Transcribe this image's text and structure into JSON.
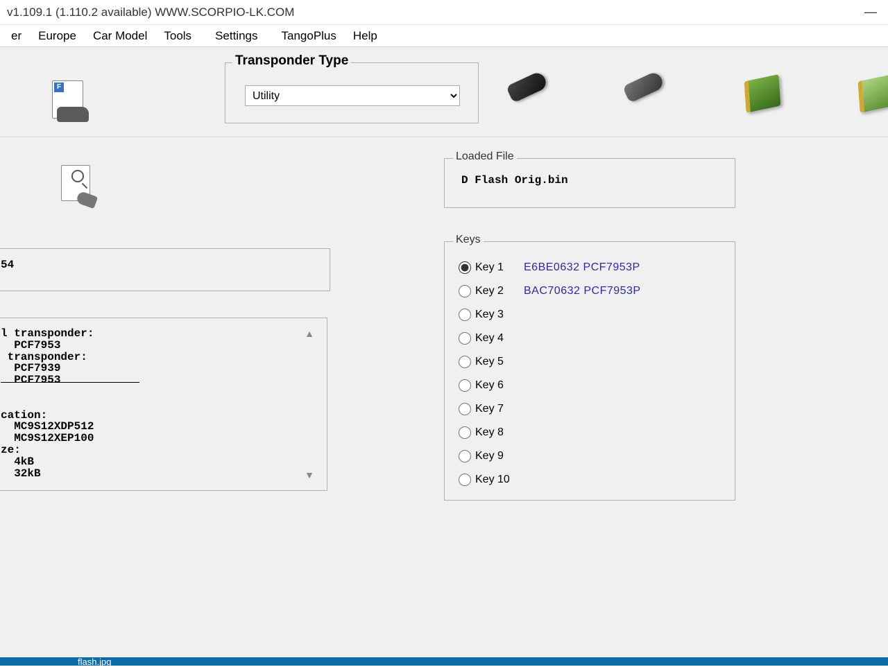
{
  "titlebar": {
    "text": " v1.109.1  (1.110.2 available)   WWW.SCORPIO-LK.COM"
  },
  "menu": {
    "items": [
      "er",
      "Europe",
      "Car Model",
      "Tools",
      "Settings",
      "TangoPlus",
      "Help"
    ]
  },
  "transponder": {
    "legend": "Transponder Type",
    "selected": "Utility"
  },
  "loadedFile": {
    "legend": "Loaded File",
    "name": "D Flash Orig.bin"
  },
  "keysBox": {
    "legend": "Keys",
    "items": [
      {
        "label": "Key 1",
        "data": "E6BE0632   PCF7953P",
        "checked": true
      },
      {
        "label": "Key 2",
        "data": "BAC70632   PCF7953P",
        "checked": false
      },
      {
        "label": "Key 3",
        "data": "",
        "checked": false
      },
      {
        "label": "Key 4",
        "data": "",
        "checked": false
      },
      {
        "label": "Key 5",
        "data": "",
        "checked": false
      },
      {
        "label": "Key 6",
        "data": "",
        "checked": false
      },
      {
        "label": "Key 7",
        "data": "",
        "checked": false
      },
      {
        "label": "Key 8",
        "data": "",
        "checked": false
      },
      {
        "label": "Key 9",
        "data": "",
        "checked": false
      },
      {
        "label": "Key 10",
        "data": "",
        "checked": false
      }
    ]
  },
  "leftInfo1": "54",
  "leftInfo2": "l transponder:\n  PCF7953\n transponder:\n  PCF7939\n  PCF7953\n\n\ncation:\n  MC9S12XDP512\n  MC9S12XEP100\nze:\n  4kB\n  32kB",
  "taskbar": {
    "item": "flash.jpg"
  }
}
